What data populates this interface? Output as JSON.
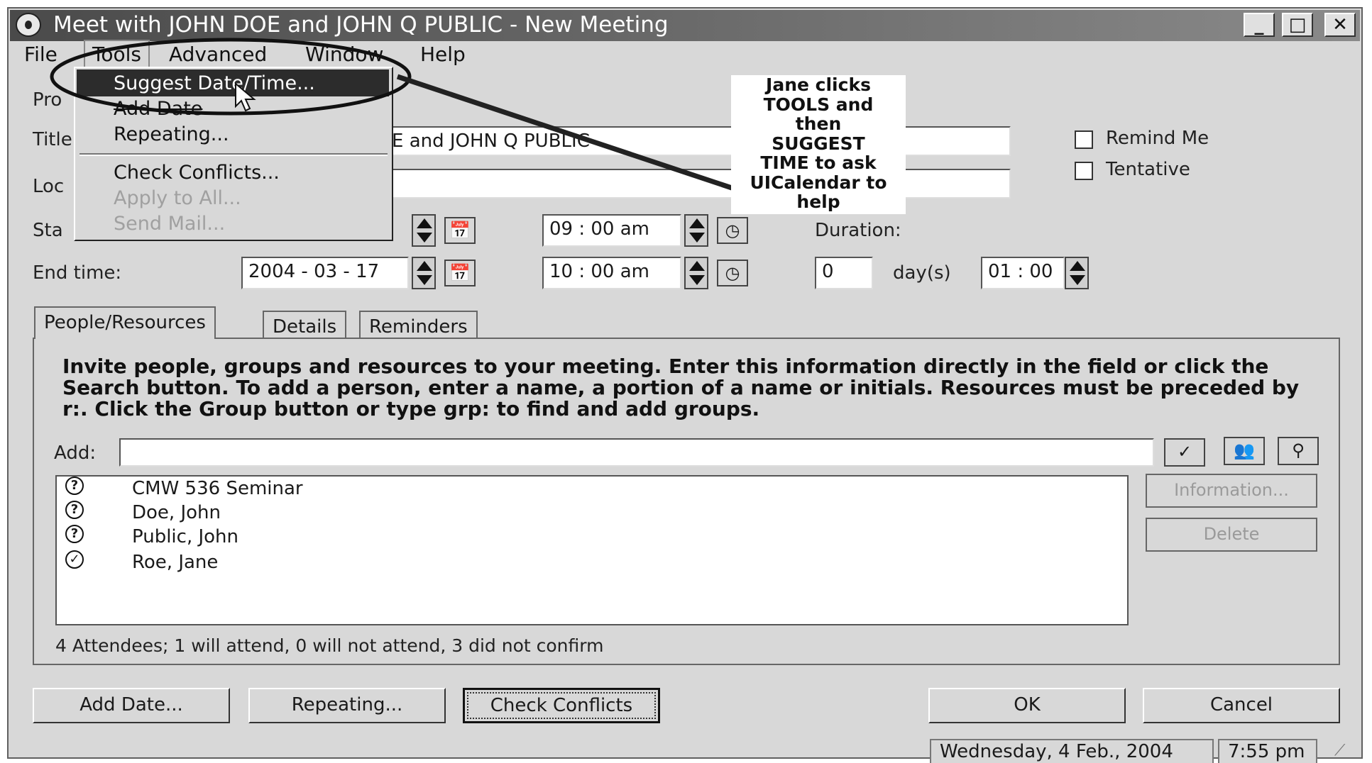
{
  "window": {
    "title": "Meet with JOHN DOE and JOHN Q PUBLIC - New Meeting",
    "controls": [
      "_",
      "□",
      "✕"
    ]
  },
  "menubar": [
    "File",
    "Tools",
    "Advanced",
    "Window",
    "Help"
  ],
  "tools_menu": {
    "items": [
      {
        "label": "Suggest Date/Time...",
        "enabled": true,
        "highlighted": true
      },
      {
        "label": "Add Date",
        "enabled": true
      },
      {
        "label": "Repeating...",
        "enabled": true
      },
      {
        "label": "Check Conflicts...",
        "enabled": true
      },
      {
        "label": "Apply to All...",
        "enabled": false
      },
      {
        "label": "Send Mail...",
        "enabled": false
      }
    ]
  },
  "form": {
    "labels_partial": {
      "pro": "Pro",
      "title": "Title",
      "location": "Loc",
      "start": "Sta"
    },
    "title_value_visible": "E and JOHN Q PUBLIC",
    "start_time": "09 : 00 am",
    "end_time_label": "End time:",
    "end_date": "2004 - 03 - 17",
    "end_time": "10 : 00 am",
    "duration_label": "Duration:",
    "duration_days": "0",
    "days_label": "day(s)",
    "duration_hours": "01 : 00",
    "remind_me": "Remind Me",
    "tentative": "Tentative"
  },
  "callout": {
    "lines": [
      "Jane clicks",
      "TOOLS and",
      "then",
      "SUGGEST",
      "TIME to ask",
      "UICalendar to",
      "help"
    ]
  },
  "tabs": [
    "People/Resources",
    "Details",
    "Reminders"
  ],
  "people": {
    "instructions": "Invite people, groups and resources to your meeting. Enter this information directly in the field or click the Search button. To add a person, enter a name, a portion of a name or initials. Resources must be preceded by r:. Click the Group button or type grp: to find and add groups.",
    "add_label": "Add:",
    "add_value": "",
    "attendees": [
      {
        "name": "CMW 536 Seminar",
        "status": "?"
      },
      {
        "name": "Doe, John",
        "status": "?"
      },
      {
        "name": "Public, John",
        "status": "?"
      },
      {
        "name": "Roe, Jane",
        "status": "✓"
      }
    ],
    "summary": "4 Attendees; 1 will attend, 0 will not attend, 3 did not confirm",
    "information_btn": "Information...",
    "delete_btn": "Delete"
  },
  "buttons": {
    "add_date": "Add Date...",
    "repeating": "Repeating...",
    "check_conflicts": "Check Conflicts",
    "ok": "OK",
    "cancel": "Cancel"
  },
  "statusbar": {
    "date": "Wednesday, 4 Feb., 2004",
    "time": "7:55 pm"
  }
}
